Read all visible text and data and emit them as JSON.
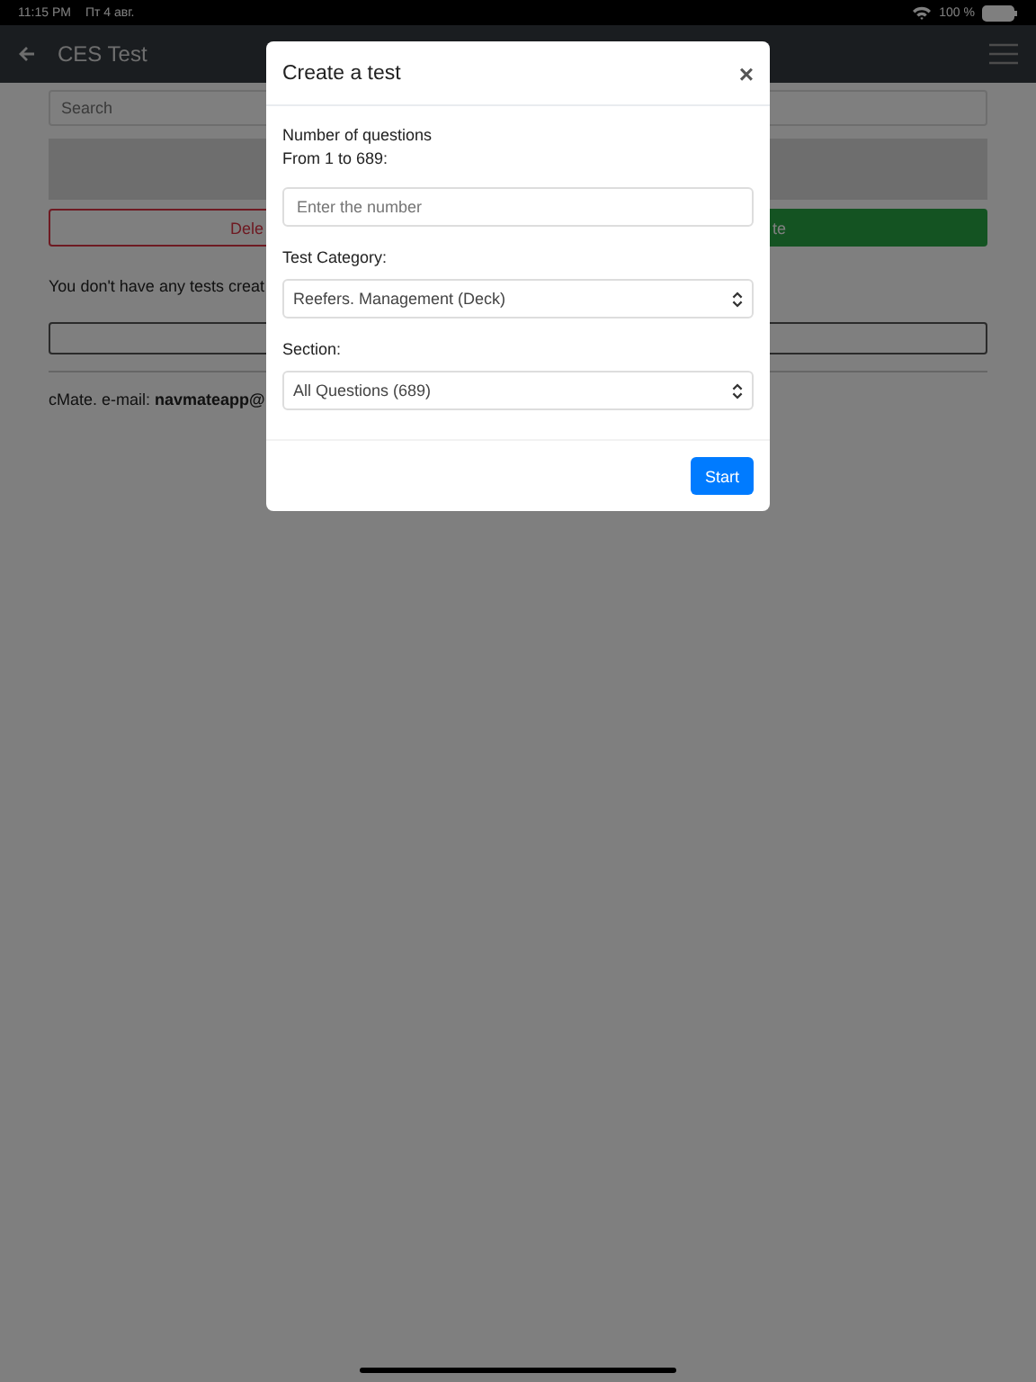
{
  "status_bar": {
    "time": "11:15 PM",
    "date": "Пт 4 авг.",
    "battery": "100 %"
  },
  "nav_bar": {
    "title": "CES Test"
  },
  "page": {
    "search": {
      "placeholder": "Search"
    },
    "delete_button": "Dele",
    "create_button": "te",
    "empty_message": "You don't have any tests creat",
    "footer": "cMate. e-mail: **navmateapp@**"
  },
  "dialog": {
    "title": "Create a test",
    "close": "×",
    "count_label": "Number of questions",
    "count_range": "From 1 to 689:",
    "count_field": {
      "placeholder": "Enter the number"
    },
    "category_label": "Test Category:",
    "category_value": "Reefers. Management (Deck)",
    "section_label": "Section:",
    "section_value": "All Questions (689)",
    "start_button": "Start"
  }
}
